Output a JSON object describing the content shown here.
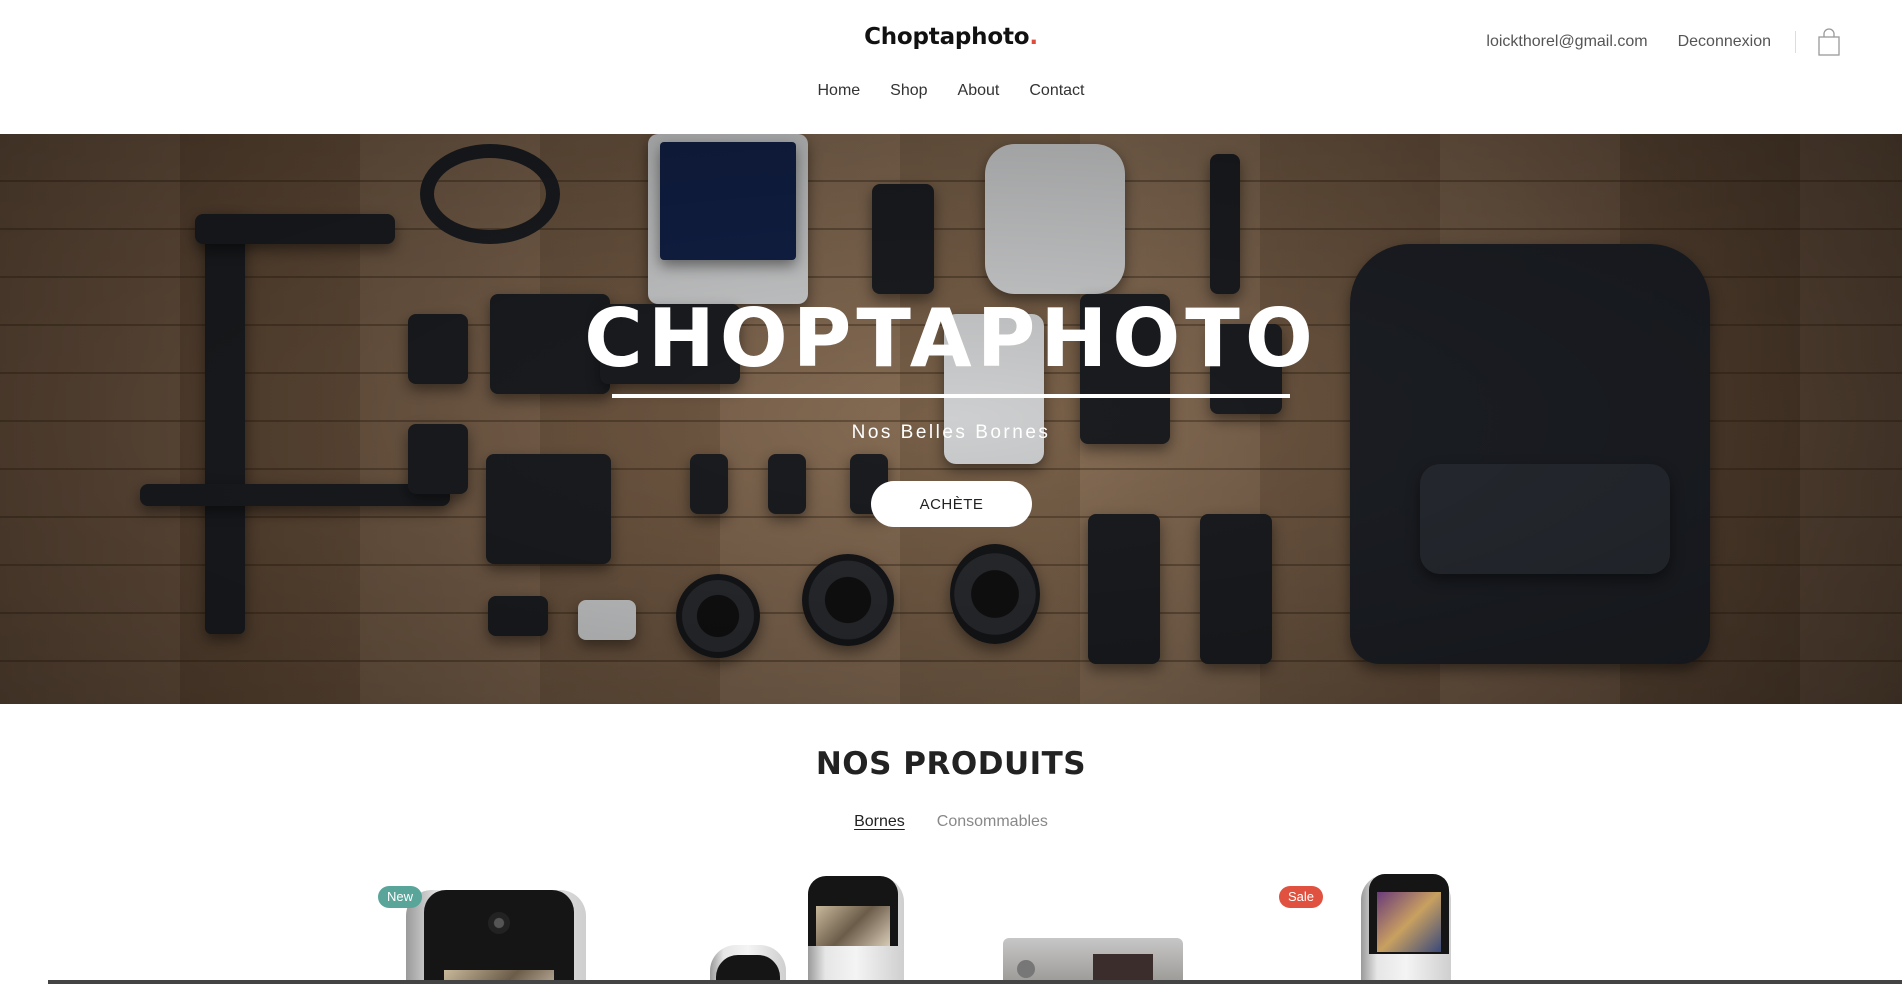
{
  "header": {
    "logo_text": "Choptaphoto",
    "logo_dot": ".",
    "email": "loickthorel@gmail.com",
    "logout_label": "Deconnexion",
    "cart_icon": "shopping-bag-icon"
  },
  "nav": {
    "items": [
      {
        "label": "Home"
      },
      {
        "label": "Shop"
      },
      {
        "label": "About"
      },
      {
        "label": "Contact"
      }
    ]
  },
  "hero": {
    "title": "CHOPTAPHOTO",
    "subtitle": "Nos Belles Bornes",
    "button_label": "ACHÈTE"
  },
  "products": {
    "title": "NOS PRODUITS",
    "filters": [
      {
        "label": "Bornes",
        "active": true
      },
      {
        "label": "Consommables",
        "active": false
      }
    ],
    "badges": {
      "new": "New",
      "sale": "Sale"
    }
  },
  "colors": {
    "accent_red": "#e14b3b",
    "badge_new": "#5aa59a",
    "badge_sale": "#e0523f"
  }
}
